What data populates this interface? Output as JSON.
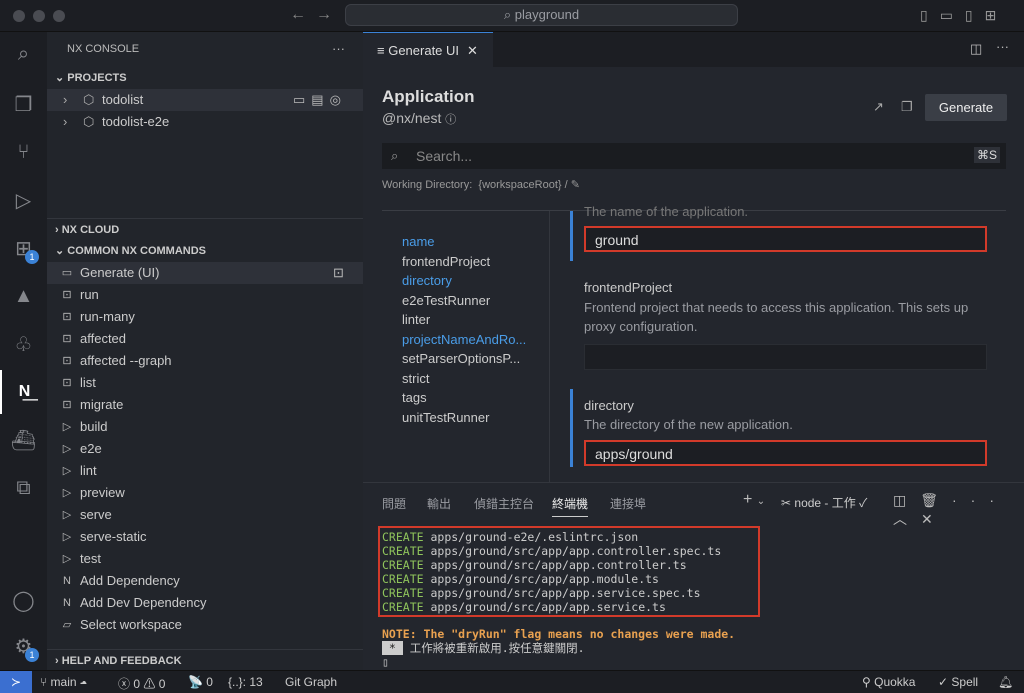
{
  "window": {
    "search": "playground"
  },
  "activity": {
    "items": [
      "search-icon",
      "files-icon",
      "source-control-icon",
      "run-debug-icon",
      "extensions-icon",
      "angular-icon",
      "tree-icon",
      "nx-icon",
      "docker-icon",
      "remote-icon"
    ],
    "extensions_badge": "1",
    "settings_badge": "1"
  },
  "sidebar": {
    "title": "NX CONSOLE",
    "more": "···",
    "projects_header": "PROJECTS",
    "projects": [
      "todolist",
      "todolist-e2e"
    ],
    "cloud_header": "NX CLOUD",
    "commands_header": "COMMON NX COMMANDS",
    "commands": [
      {
        "icon": "window",
        "label": "Generate (UI)"
      },
      {
        "icon": "term",
        "label": "run"
      },
      {
        "icon": "term",
        "label": "run-many"
      },
      {
        "icon": "term",
        "label": "affected"
      },
      {
        "icon": "term",
        "label": "affected --graph"
      },
      {
        "icon": "term",
        "label": "list"
      },
      {
        "icon": "term",
        "label": "migrate"
      },
      {
        "icon": "play",
        "label": "build"
      },
      {
        "icon": "play",
        "label": "e2e"
      },
      {
        "icon": "play",
        "label": "lint"
      },
      {
        "icon": "play",
        "label": "preview"
      },
      {
        "icon": "play",
        "label": "serve"
      },
      {
        "icon": "play",
        "label": "serve-static"
      },
      {
        "icon": "play",
        "label": "test"
      },
      {
        "icon": "nx",
        "label": "Add Dependency"
      },
      {
        "icon": "nx",
        "label": "Add Dev Dependency"
      },
      {
        "icon": "folder",
        "label": "Select workspace"
      }
    ],
    "help_header": "HELP AND FEEDBACK"
  },
  "editor": {
    "tab": "Generate UI",
    "title": "Application",
    "subtitle": "@nx/nest",
    "generate": "Generate",
    "search_placeholder": "Search...",
    "shortcut": "⌘S",
    "working_dir_label": "Working Directory:",
    "working_dir": "{workspaceRoot}",
    "working_dir_sep": "/",
    "nav": [
      {
        "label": "name",
        "active": true
      },
      {
        "label": "frontendProject",
        "active": false
      },
      {
        "label": "directory",
        "active": true
      },
      {
        "label": "e2eTestRunner",
        "active": false
      },
      {
        "label": "linter",
        "active": false
      },
      {
        "label": "projectNameAndRo...",
        "active": true
      },
      {
        "label": "setParserOptionsP...",
        "active": false
      },
      {
        "label": "strict",
        "active": false
      },
      {
        "label": "tags",
        "active": false
      },
      {
        "label": "unitTestRunner",
        "active": false
      }
    ],
    "fields": {
      "name_desc": "The name of the application.",
      "name_value": "ground",
      "frontend_label": "frontendProject",
      "frontend_desc": "Frontend project that needs to access this application. This sets up proxy configuration.",
      "frontend_value": "",
      "directory_label": "directory",
      "directory_desc": "The directory of the new application.",
      "directory_value": "apps/ground"
    }
  },
  "panel": {
    "tabs": [
      "問題",
      "輸出",
      "偵錯主控台",
      "終端機",
      "連接埠"
    ],
    "active_tab": "終端機",
    "terminal_name": "node - 工作",
    "lines": [
      {
        "kw": "CREATE",
        "path": "apps/ground-e2e/.eslintrc.json"
      },
      {
        "kw": "CREATE",
        "path": "apps/ground/src/app/app.controller.spec.ts"
      },
      {
        "kw": "CREATE",
        "path": "apps/ground/src/app/app.controller.ts"
      },
      {
        "kw": "CREATE",
        "path": "apps/ground/src/app/app.module.ts"
      },
      {
        "kw": "CREATE",
        "path": "apps/ground/src/app/app.service.spec.ts"
      },
      {
        "kw": "CREATE",
        "path": "apps/ground/src/app/app.service.ts"
      }
    ],
    "note": "NOTE: The \"dryRun\" flag means no changes were made.",
    "star": " * ",
    "reuse": "工作將被重新啟用.按任意鍵關閉."
  },
  "status": {
    "branch": "main",
    "errors": "0",
    "warnings": "0",
    "ports": "0",
    "symbols": "{..}: 13",
    "git_graph": "Git Graph",
    "quokka": "Quokka",
    "spell": "Spell"
  },
  "colors": {
    "accent": "#3b82d6",
    "error_outline": "#d23a2a",
    "create": "#8fc45b",
    "note": "#e8a150"
  }
}
